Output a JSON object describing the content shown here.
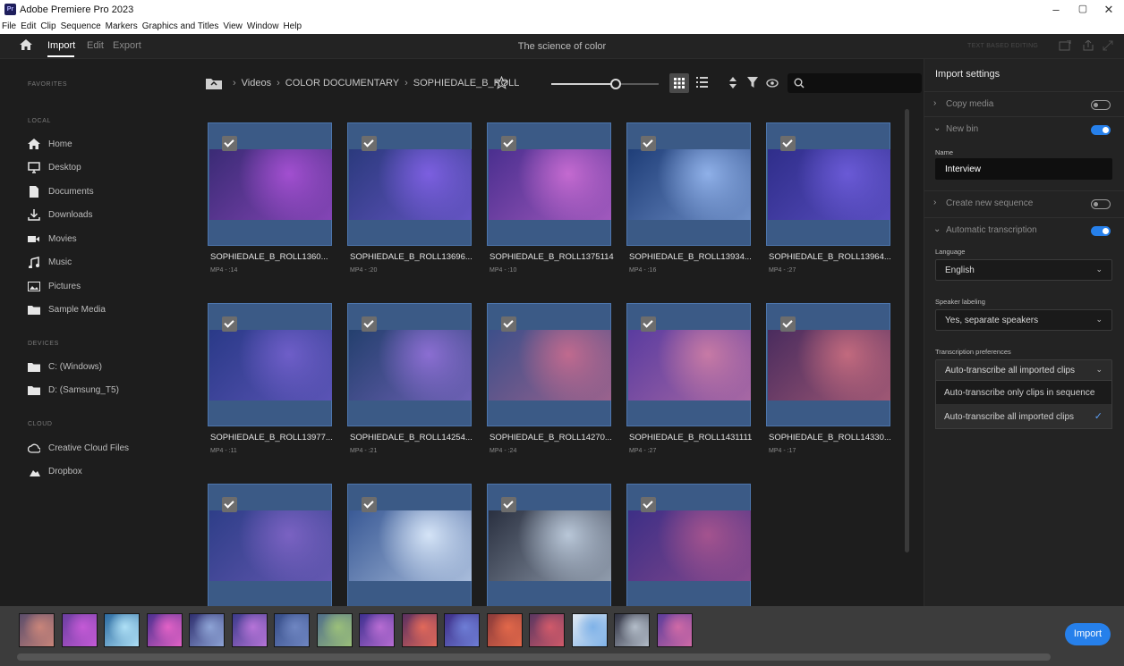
{
  "app": {
    "title": "Adobe Premiere Pro 2023",
    "icon_label": "Pr"
  },
  "window": {
    "minimize": "–",
    "maximize": "▢",
    "close": "✕"
  },
  "menu": [
    "File",
    "Edit",
    "Clip",
    "Sequence",
    "Markers",
    "Graphics and Titles",
    "View",
    "Window",
    "Help"
  ],
  "header": {
    "tabs": [
      "Import",
      "Edit",
      "Export"
    ],
    "active_tab": "Import",
    "document": "The science of color",
    "text_based_editing": "TEXT BASED EDITING"
  },
  "sidebar": {
    "favorites": "FAVORITES",
    "local": "LOCAL",
    "devices_title": "DEVICES",
    "cloud_title": "CLOUD",
    "local_items": [
      {
        "label": "Home",
        "icon": "home-icon"
      },
      {
        "label": "Desktop",
        "icon": "desktop-icon"
      },
      {
        "label": "Documents",
        "icon": "document-icon"
      },
      {
        "label": "Downloads",
        "icon": "download-icon"
      },
      {
        "label": "Movies",
        "icon": "movie-icon"
      },
      {
        "label": "Music",
        "icon": "music-icon"
      },
      {
        "label": "Pictures",
        "icon": "pictures-icon"
      },
      {
        "label": "Sample Media",
        "icon": "folder-icon"
      }
    ],
    "devices": [
      {
        "label": "C: (Windows)",
        "icon": "folder-icon"
      },
      {
        "label": "D: (Samsung_T5)",
        "icon": "folder-icon"
      }
    ],
    "cloud": [
      {
        "label": "Creative Cloud Files",
        "icon": "creative-cloud-icon"
      },
      {
        "label": "Dropbox",
        "icon": "dropbox-icon"
      }
    ]
  },
  "breadcrumb": [
    "Videos",
    "COLOR DOCUMENTARY",
    "SOPHIEDALE_B_ROLL"
  ],
  "zoom_level": 0.6,
  "clips": [
    {
      "name": "SOPHIEDALE_B_ROLL1360...",
      "meta": "MP4 - :14",
      "colors": [
        "#3a2b75",
        "#a24fd0"
      ]
    },
    {
      "name": "SOPHIEDALE_B_ROLL13696...",
      "meta": "MP4 - :20",
      "colors": [
        "#2b3a7d",
        "#7c5fe0"
      ]
    },
    {
      "name": "SOPHIEDALE_B_ROLL1375114",
      "meta": "MP4 - :10",
      "colors": [
        "#4a2f8f",
        "#c46ad0"
      ]
    },
    {
      "name": "SOPHIEDALE_B_ROLL13934...",
      "meta": "MP4 - :16",
      "colors": [
        "#1f3e78",
        "#8fb0e8"
      ]
    },
    {
      "name": "SOPHIEDALE_B_ROLL13964...",
      "meta": "MP4 - :27",
      "colors": [
        "#2f2e8a",
        "#6a5ad6"
      ]
    },
    {
      "name": "SOPHIEDALE_B_ROLL13977...",
      "meta": "MP4 - :11",
      "colors": [
        "#2a3a88",
        "#6e5ec8"
      ]
    },
    {
      "name": "SOPHIEDALE_B_ROLL14254...",
      "meta": "MP4 - :21",
      "colors": [
        "#24406e",
        "#8b6ed2"
      ]
    },
    {
      "name": "SOPHIEDALE_B_ROLL14270...",
      "meta": "MP4 - :24",
      "colors": [
        "#3d4f8a",
        "#c06a8e"
      ]
    },
    {
      "name": "SOPHIEDALE_B_ROLL1431111",
      "meta": "MP4 - :27",
      "colors": [
        "#5a3ca0",
        "#c77aa5"
      ]
    },
    {
      "name": "SOPHIEDALE_B_ROLL14330...",
      "meta": "MP4 - :17",
      "colors": [
        "#4a2c5e",
        "#c26a7e"
      ]
    },
    {
      "name": "",
      "meta": "",
      "colors": [
        "#2e3e88",
        "#7a62c2"
      ]
    },
    {
      "name": "",
      "meta": "",
      "colors": [
        "#3a5a96",
        "#d5e4f7"
      ]
    },
    {
      "name": "",
      "meta": "",
      "colors": [
        "#2a3040",
        "#b9c7d8"
      ]
    },
    {
      "name": "",
      "meta": "",
      "colors": [
        "#3d2f86",
        "#a4538e"
      ]
    }
  ],
  "filmstrip": [
    [
      "#5a4c6a",
      "#c9857a"
    ],
    [
      "#6a3ea0",
      "#c45ad6"
    ],
    [
      "#2b6aa0",
      "#aee0f6"
    ],
    [
      "#4b2f8f",
      "#e262c6"
    ],
    [
      "#2e2e6e",
      "#8ea4d6"
    ],
    [
      "#3a3a8a",
      "#b674d8"
    ],
    [
      "#344b86",
      "#6f86c2"
    ],
    [
      "#4f6d8a",
      "#9bc07a"
    ],
    [
      "#3d2f8f",
      "#b86dd3"
    ],
    [
      "#5a2f60",
      "#e2695a"
    ],
    [
      "#3d2d86",
      "#6e7ed6"
    ],
    [
      "#8a3a3a",
      "#e2684a"
    ],
    [
      "#5a3660",
      "#d15a6a"
    ],
    [
      "#dfe8f2",
      "#7fb2e8"
    ],
    [
      "#2e3040",
      "#b3bdc9"
    ],
    [
      "#5a3c9a",
      "#d06aa6"
    ]
  ],
  "panel": {
    "title": "Import settings",
    "copy_media": "Copy media",
    "copy_media_on": false,
    "new_bin": "New bin",
    "new_bin_on": true,
    "name_label": "Name",
    "name_value": "Interview",
    "create_sequence": "Create new sequence",
    "create_sequence_on": false,
    "auto_transcription": "Automatic transcription",
    "auto_transcription_on": true,
    "language_label": "Language",
    "language_value": "English",
    "speaker_label": "Speaker labeling",
    "speaker_value": "Yes, separate speakers",
    "transcription_pref_label": "Transcription preferences",
    "transcription_pref_value": "Auto-transcribe all imported clips",
    "transcription_options": [
      "Auto-transcribe only clips in sequence",
      "Auto-transcribe all imported clips"
    ],
    "selected_option": 1
  },
  "import_button": "Import",
  "accent": "#2680eb"
}
